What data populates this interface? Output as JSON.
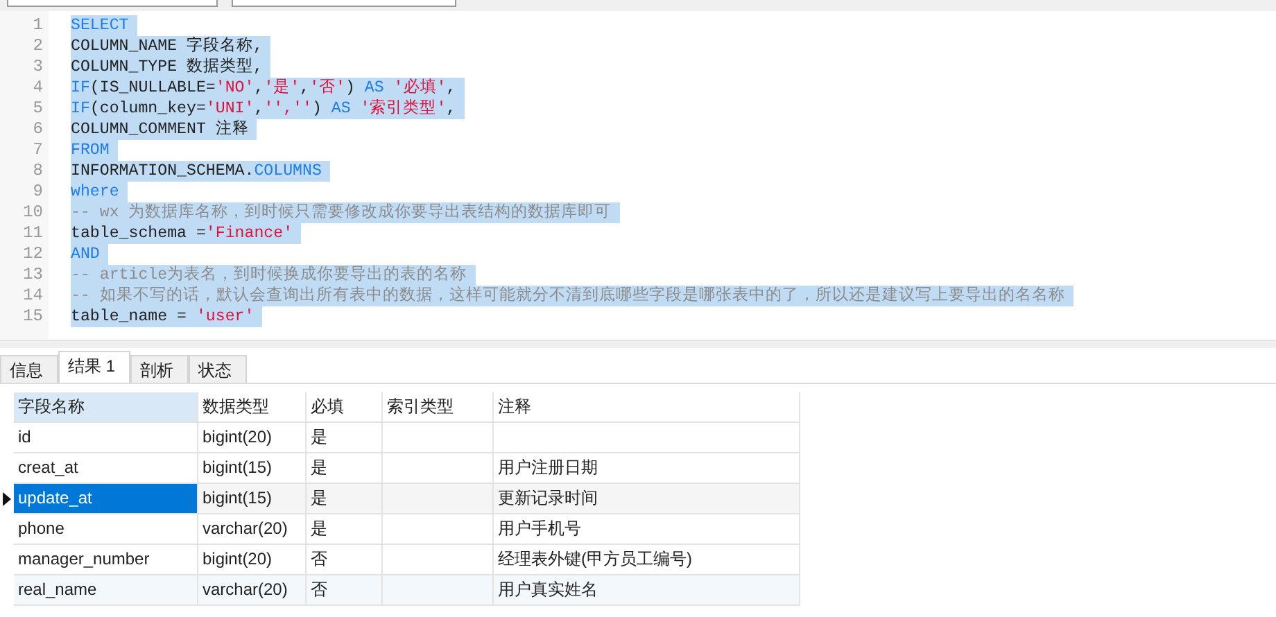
{
  "editor": {
    "lines": [
      {
        "number": "1",
        "tokens": [
          {
            "kind": "kw",
            "text": "SELECT"
          }
        ]
      },
      {
        "number": "2",
        "tokens": [
          {
            "kind": "plain",
            "text": "COLUMN_NAME 字段名称,"
          }
        ]
      },
      {
        "number": "3",
        "tokens": [
          {
            "kind": "plain",
            "text": "COLUMN_TYPE 数据类型,"
          }
        ]
      },
      {
        "number": "4",
        "tokens": [
          {
            "kind": "kw",
            "text": "IF"
          },
          {
            "kind": "plain",
            "text": "(IS_NULLABLE="
          },
          {
            "kind": "str",
            "text": "'NO'"
          },
          {
            "kind": "plain",
            "text": ","
          },
          {
            "kind": "str",
            "text": "'是'"
          },
          {
            "kind": "plain",
            "text": ","
          },
          {
            "kind": "str",
            "text": "'否'"
          },
          {
            "kind": "plain",
            "text": ") "
          },
          {
            "kind": "kw",
            "text": "AS"
          },
          {
            "kind": "str",
            "text": " '必填'"
          },
          {
            "kind": "plain",
            "text": ","
          }
        ]
      },
      {
        "number": "5",
        "tokens": [
          {
            "kind": "kw",
            "text": "IF"
          },
          {
            "kind": "plain",
            "text": "(column_key="
          },
          {
            "kind": "str",
            "text": "'UNI'"
          },
          {
            "kind": "plain",
            "text": ","
          },
          {
            "kind": "str",
            "text": "'',''"
          },
          {
            "kind": "plain",
            "text": ") "
          },
          {
            "kind": "kw",
            "text": "AS"
          },
          {
            "kind": "str",
            "text": " '索引类型'"
          },
          {
            "kind": "plain",
            "text": ","
          }
        ]
      },
      {
        "number": "6",
        "tokens": [
          {
            "kind": "plain",
            "text": "COLUMN_COMMENT 注释"
          }
        ]
      },
      {
        "number": "7",
        "tokens": [
          {
            "kind": "kw",
            "text": "FROM"
          }
        ]
      },
      {
        "number": "8",
        "tokens": [
          {
            "kind": "plain",
            "text": "INFORMATION_SCHEMA."
          },
          {
            "kind": "kw",
            "text": "COLUMNS"
          }
        ]
      },
      {
        "number": "9",
        "tokens": [
          {
            "kind": "kw",
            "text": "where"
          }
        ]
      },
      {
        "number": "10",
        "tokens": [
          {
            "kind": "cm",
            "text": "-- wx 为数据库名称，到时候只需要修改成你要导出表结构的数据库即可"
          }
        ]
      },
      {
        "number": "11",
        "tokens": [
          {
            "kind": "plain",
            "text": "table_schema ="
          },
          {
            "kind": "str",
            "text": "'Finance'"
          }
        ]
      },
      {
        "number": "12",
        "tokens": [
          {
            "kind": "kw",
            "text": "AND"
          }
        ]
      },
      {
        "number": "13",
        "tokens": [
          {
            "kind": "cm",
            "text": "-- article为表名，到时候换成你要导出的表的名称"
          }
        ]
      },
      {
        "number": "14",
        "tokens": [
          {
            "kind": "cm",
            "text": "-- 如果不写的话，默认会查询出所有表中的数据，这样可能就分不清到底哪些字段是哪张表中的了，所以还是建议写上要导出的名名称"
          }
        ]
      },
      {
        "number": "15",
        "tokens": [
          {
            "kind": "plain",
            "text": "table_name = "
          },
          {
            "kind": "str",
            "text": "'user'"
          }
        ]
      }
    ]
  },
  "result_tabs": [
    {
      "label": "信息",
      "selected": false
    },
    {
      "label": "结果 1",
      "selected": true
    },
    {
      "label": "剖析",
      "selected": false
    },
    {
      "label": "状态",
      "selected": false
    }
  ],
  "table": {
    "columns": [
      "字段名称",
      "数据类型",
      "必填",
      "索引类型",
      "注释"
    ],
    "rows": [
      {
        "name": "id",
        "type": "bigint(20)",
        "required": "是",
        "selected": false
      },
      {
        "name": "creat_at",
        "type": "bigint(15)",
        "required": "是",
        "comment": "用户注册日期",
        "selected": false
      },
      {
        "name": "update_at",
        "type": "bigint(15)",
        "required": "是",
        "comment": "更新记录时间",
        "selected": true
      },
      {
        "name": "phone",
        "type": "varchar(20)",
        "required": "是",
        "comment": "用户手机号",
        "selected": false
      },
      {
        "name": "manager_number",
        "type": "bigint(20)",
        "required": "否",
        "comment": "经理表外键(甲方员工编号)",
        "selected": false
      },
      {
        "name": "real_name",
        "type": "varchar(20)",
        "required": "否",
        "comment": "用户真实姓名",
        "selected": false
      }
    ]
  }
}
